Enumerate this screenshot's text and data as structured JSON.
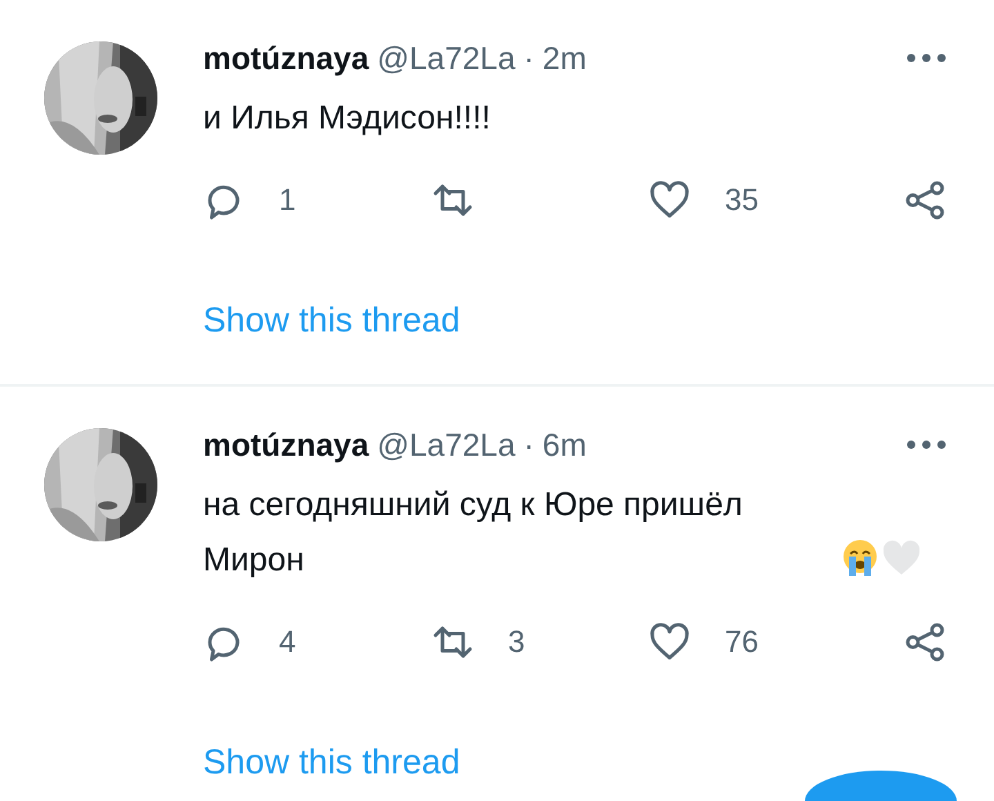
{
  "tweets": [
    {
      "name": "motúznaya",
      "handle": "@La72La",
      "separator": "·",
      "time": "2m",
      "text": "и Илья Мэдисон!!!!",
      "replies": "1",
      "likes": "35",
      "thread_link": "Show this thread"
    },
    {
      "name": "motúznaya",
      "handle": "@La72La",
      "separator": "·",
      "time": "6m",
      "text": "на сегодняшний суд к Юре пришёл Мирон",
      "emoji": [
        {
          "kind": "crying"
        },
        {
          "kind": "white-heart"
        }
      ],
      "replies": "4",
      "retweets": "3",
      "likes": "76",
      "thread_link": "Show this thread"
    }
  ]
}
